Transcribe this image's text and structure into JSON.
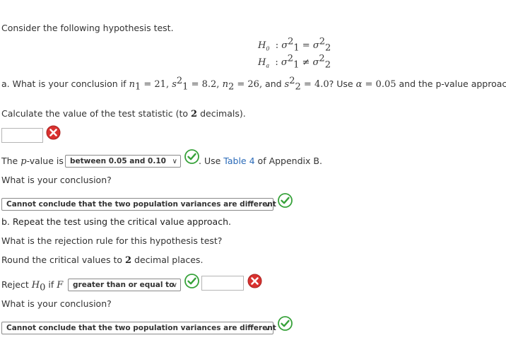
{
  "intro": "Consider the following hypothesis test.",
  "hypotheses": {
    "h0_label": "H",
    "h0_sub": "0",
    "ha_label": "H",
    "ha_sub": "a"
  },
  "part_a": {
    "prefix": "a. What is your conclusion if",
    "n1": "21",
    "s1sq": "8.2",
    "n2": "26",
    "s2sq": "4.0",
    "use_text": "? Use",
    "alpha": "0.05",
    "approach_text": "and the p-value approach."
  },
  "test_statistic": {
    "prompt_before": "Calculate the value of the test statistic (to",
    "decimals": "2",
    "prompt_after": "decimals).",
    "value": ""
  },
  "p_value": {
    "label_before": "The",
    "label_after": "-value is",
    "selected": "between 0.05 and 0.10",
    "table_text_before": ". Use",
    "table_link": "Table 4",
    "table_text_after": "of Appendix B."
  },
  "conclusion_a": {
    "question": "What is your conclusion?",
    "selected": "Cannot conclude that the two population variances are different"
  },
  "part_b": {
    "heading": "b. Repeat the test using the critical value approach.",
    "rule_question": "What is the rejection rule for this hypothesis test?",
    "round_before": "Round the critical values to",
    "round_decimals": "2",
    "round_after": "decimal places.",
    "reject_text": "Reject",
    "if_text": "if",
    "comparison_selected": "greater than or equal to",
    "critical_value": "",
    "question": "What is your conclusion?",
    "conclusion_selected": "Cannot conclude that the two population variances are different"
  }
}
